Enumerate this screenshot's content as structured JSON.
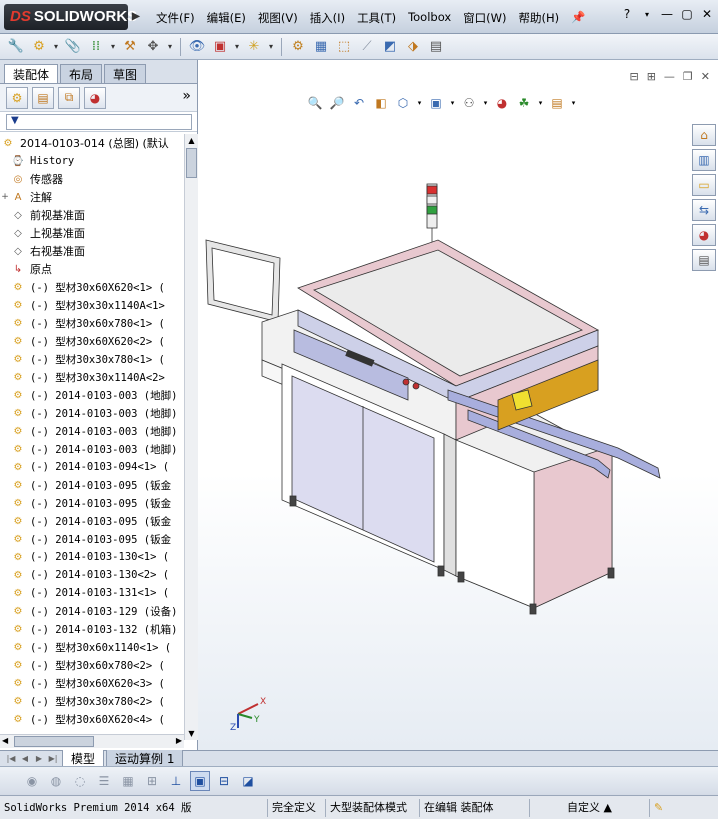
{
  "app": {
    "brand_prefix": "DS",
    "brand": "SOLIDWORKS"
  },
  "menu": [
    "文件(F)",
    "编辑(E)",
    "视图(V)",
    "插入(I)",
    "工具(T)",
    "Toolbox",
    "窗口(W)",
    "帮助(H)"
  ],
  "window_controls": {
    "help": "?",
    "minimize": "—",
    "restore": "▢",
    "close": "✕"
  },
  "panel_tabs": [
    "装配体",
    "布局",
    "草图"
  ],
  "tree": {
    "root": "2014-0103-014 (总图)  (默认",
    "items": [
      {
        "label": "History",
        "icon": "history-icon",
        "mono": true,
        "exp": ""
      },
      {
        "label": "传感器",
        "icon": "sensor-icon",
        "mono": false,
        "exp": ""
      },
      {
        "label": "注解",
        "icon": "annotation-icon",
        "mono": false,
        "exp": "+"
      },
      {
        "label": "前视基准面",
        "icon": "plane-icon",
        "mono": false,
        "exp": ""
      },
      {
        "label": "上视基准面",
        "icon": "plane-icon",
        "mono": false,
        "exp": ""
      },
      {
        "label": "右视基准面",
        "icon": "plane-icon",
        "mono": false,
        "exp": ""
      },
      {
        "label": "原点",
        "icon": "origin-icon",
        "mono": false,
        "exp": ""
      },
      {
        "label": "(-) 型材30x60X620<1> (",
        "icon": "part-icon",
        "mono": true,
        "exp": ""
      },
      {
        "label": "(-) 型材30x30x1140A<1>",
        "icon": "part-icon",
        "mono": true,
        "exp": ""
      },
      {
        "label": "(-) 型材30x60x780<1> (",
        "icon": "part-icon",
        "mono": true,
        "exp": ""
      },
      {
        "label": "(-) 型材30x60X620<2> (",
        "icon": "part-icon",
        "mono": true,
        "exp": ""
      },
      {
        "label": "(-) 型材30x30x780<1> (",
        "icon": "part-icon",
        "mono": true,
        "exp": ""
      },
      {
        "label": "(-) 型材30x30x1140A<2>",
        "icon": "part-icon",
        "mono": true,
        "exp": ""
      },
      {
        "label": "(-) 2014-0103-003 (地脚)",
        "icon": "part-icon",
        "mono": true,
        "exp": ""
      },
      {
        "label": "(-) 2014-0103-003 (地脚)",
        "icon": "part-icon",
        "mono": true,
        "exp": ""
      },
      {
        "label": "(-) 2014-0103-003 (地脚)",
        "icon": "part-icon",
        "mono": true,
        "exp": ""
      },
      {
        "label": "(-) 2014-0103-003 (地脚)",
        "icon": "part-icon",
        "mono": true,
        "exp": ""
      },
      {
        "label": "(-) 2014-0103-094<1> (",
        "icon": "part-icon",
        "mono": true,
        "exp": ""
      },
      {
        "label": "(-) 2014-0103-095 (钣金",
        "icon": "part-icon",
        "mono": true,
        "exp": ""
      },
      {
        "label": "(-) 2014-0103-095 (钣金",
        "icon": "part-icon",
        "mono": true,
        "exp": ""
      },
      {
        "label": "(-) 2014-0103-095 (钣金",
        "icon": "part-icon",
        "mono": true,
        "exp": ""
      },
      {
        "label": "(-) 2014-0103-095 (钣金",
        "icon": "part-icon",
        "mono": true,
        "exp": ""
      },
      {
        "label": "(-) 2014-0103-130<1> (",
        "icon": "part-icon",
        "mono": true,
        "exp": ""
      },
      {
        "label": "(-) 2014-0103-130<2> (",
        "icon": "part-icon",
        "mono": true,
        "exp": ""
      },
      {
        "label": "(-) 2014-0103-131<1> (",
        "icon": "part-icon",
        "mono": true,
        "exp": ""
      },
      {
        "label": "(-) 2014-0103-129 (设备)",
        "icon": "part-icon",
        "mono": true,
        "exp": ""
      },
      {
        "label": "(-) 2014-0103-132 (机箱)",
        "icon": "part-icon",
        "mono": true,
        "exp": ""
      },
      {
        "label": "(-) 型材30x60x1140<1> (",
        "icon": "part-icon",
        "mono": true,
        "exp": ""
      },
      {
        "label": "(-) 型材30x60x780<2> (",
        "icon": "part-icon",
        "mono": true,
        "exp": ""
      },
      {
        "label": "(-) 型材30x60X620<3> (",
        "icon": "part-icon",
        "mono": true,
        "exp": ""
      },
      {
        "label": "(-) 型材30x30x780<2> (",
        "icon": "part-icon",
        "mono": true,
        "exp": ""
      },
      {
        "label": "(-) 型材30x60X620<4> (",
        "icon": "part-icon",
        "mono": true,
        "exp": ""
      }
    ]
  },
  "bottom_tabs": [
    "模型",
    "运动算例 1"
  ],
  "status": [
    "SolidWorks Premium 2014 x64 版",
    "完全定义",
    "大型装配体模式",
    "在编辑 装配体",
    "自定义 ▲"
  ],
  "triad": {
    "x": "X",
    "y": "Y",
    "z": "Z"
  },
  "colors": {
    "accent": "#1f4fa0",
    "frame_pink": "#e8c8cf",
    "sheet": "#cdd0e8"
  }
}
